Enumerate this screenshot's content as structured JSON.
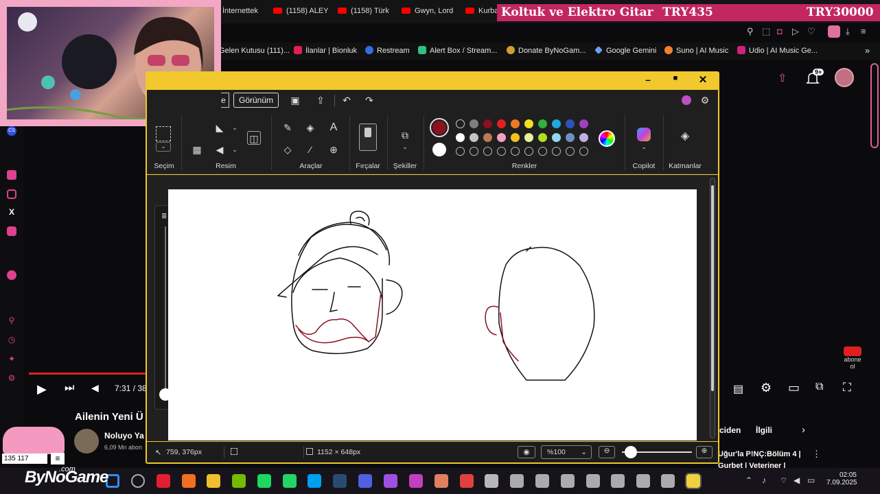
{
  "browser": {
    "tabs": [
      {
        "label": "İnternettek"
      },
      {
        "label": "(1158) ALEY"
      },
      {
        "label": "(1158) Türk"
      },
      {
        "label": "Gwyn, Lord"
      },
      {
        "label": "Kurba"
      }
    ],
    "bookmarks": [
      {
        "label": "Gelen Kutusu (111)..."
      },
      {
        "label": "İlanlar | Bionluk"
      },
      {
        "label": "Restream"
      },
      {
        "label": "Alert Box / Stream..."
      },
      {
        "label": "Donate ByNoGam..."
      },
      {
        "label": "Google Gemini"
      },
      {
        "label": "Suno | AI Music"
      },
      {
        "label": "Udio | AI Music Ge..."
      }
    ]
  },
  "donation_banner": {
    "item": "Koltuk ve Elektro Gitar",
    "current": "TRY435",
    "goal": "TRY30000"
  },
  "youtube": {
    "notification_count": "9+",
    "time": "7:31 / 38",
    "video_title": "Ailenin Yeni Ü",
    "channel_name": "Noluyo Ya",
    "subscribers": "6,09 Mn abon",
    "tabs": [
      "ciden",
      "İlgili"
    ],
    "next_title": "Uğur'la P!NÇ:Bölüm 4 |",
    "next_sub": "Gurbet | Veteriner |",
    "subscribe_watermark": "abone ol"
  },
  "overlay": {
    "counter": "135 117",
    "logo": "ByNoGame",
    "logo_suffix": ".com"
  },
  "paint": {
    "menu": {
      "partial": "e",
      "view": "Görünüm"
    },
    "groups": {
      "selection": "Seçim",
      "image": "Resim",
      "tools": "Araçlar",
      "brushes": "Fırçalar",
      "shapes": "Şekiller",
      "colors": "Renkler",
      "copilot": "Copilot",
      "layers": "Katmanlar"
    },
    "colors": {
      "primary": "#8b1020",
      "row1": [
        "#1f1f1f",
        "#7f7f7f",
        "#8b1020",
        "#e32020",
        "#f07820",
        "#f0e020",
        "#30b040",
        "#20a8e0",
        "#3050c0",
        "#a040c0"
      ],
      "row2": [
        "#ffffff",
        "#c3c3c3",
        "#b97a57",
        "#f5a0c0",
        "#f5c020",
        "#e8f0a0",
        "#b0e020",
        "#90d8f0",
        "#7090c0",
        "#c0b0e0"
      ]
    },
    "status": {
      "cursor": "759, 376px",
      "canvas_size": "1152 × 648px",
      "zoom": "%100"
    }
  },
  "taskbar": {
    "time": "02:05",
    "date": "7.09.2025"
  }
}
